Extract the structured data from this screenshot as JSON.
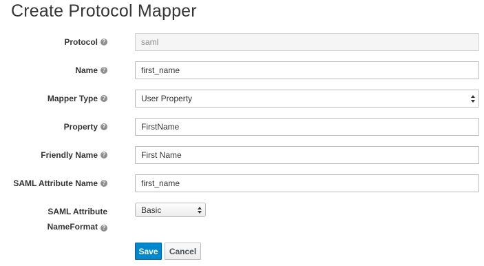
{
  "page": {
    "title": "Create Protocol Mapper"
  },
  "form": {
    "protocol": {
      "label": "Protocol",
      "value": "saml"
    },
    "name": {
      "label": "Name",
      "value": "first_name"
    },
    "mapper_type": {
      "label": "Mapper Type",
      "value": "User Property"
    },
    "property": {
      "label": "Property",
      "value": "FirstName"
    },
    "friendly_name": {
      "label": "Friendly Name",
      "value": "First Name"
    },
    "saml_attribute_name": {
      "label": "SAML Attribute Name",
      "value": "first_name"
    },
    "saml_attribute_nameformat": {
      "label_line1": "SAML Attribute",
      "label_line2": "NameFormat",
      "value": "Basic"
    },
    "help_icon_glyph": "?"
  },
  "actions": {
    "save_label": "Save",
    "cancel_label": "Cancel"
  },
  "colors": {
    "primary": "#0088ce",
    "help_icon": "#8b8d8f",
    "readonly_bg": "#f5f5f5"
  }
}
